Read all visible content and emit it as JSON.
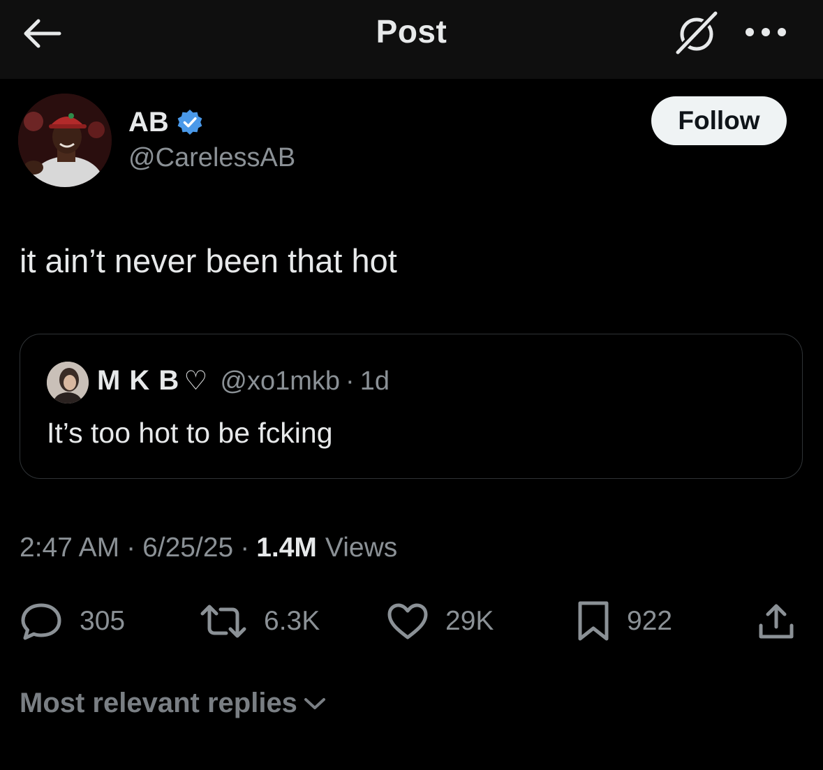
{
  "header": {
    "title": "Post",
    "back_icon": "arrow-left-icon",
    "grok_icon": "grok-icon",
    "more_icon": "more-dots-icon"
  },
  "author": {
    "name": "AB",
    "handle": "@CarelessAB",
    "verified": true,
    "verified_color": "#4a99e9",
    "follow_label": "Follow"
  },
  "post": {
    "text": "it ain’t never been that hot"
  },
  "quote": {
    "name": "M K B",
    "heart": "♡",
    "handle": "@xo1mkb",
    "separator": "·",
    "time": "1d",
    "text": "It’s too hot to be fcking"
  },
  "meta": {
    "time": "2:47 AM",
    "sep1": "·",
    "date": "6/25/25",
    "sep2": "·",
    "views_count": "1.4M",
    "views_label": "Views"
  },
  "actions": {
    "replies": "305",
    "reposts": "6.3K",
    "likes": "29K",
    "bookmarks": "922"
  },
  "replies_sort": {
    "label": "Most relevant replies"
  },
  "colors": {
    "background": "#000000",
    "header_bg": "#0f0f0f",
    "text_primary": "#e7e9ea",
    "text_secondary": "#8b9196",
    "border": "#2f3336"
  }
}
